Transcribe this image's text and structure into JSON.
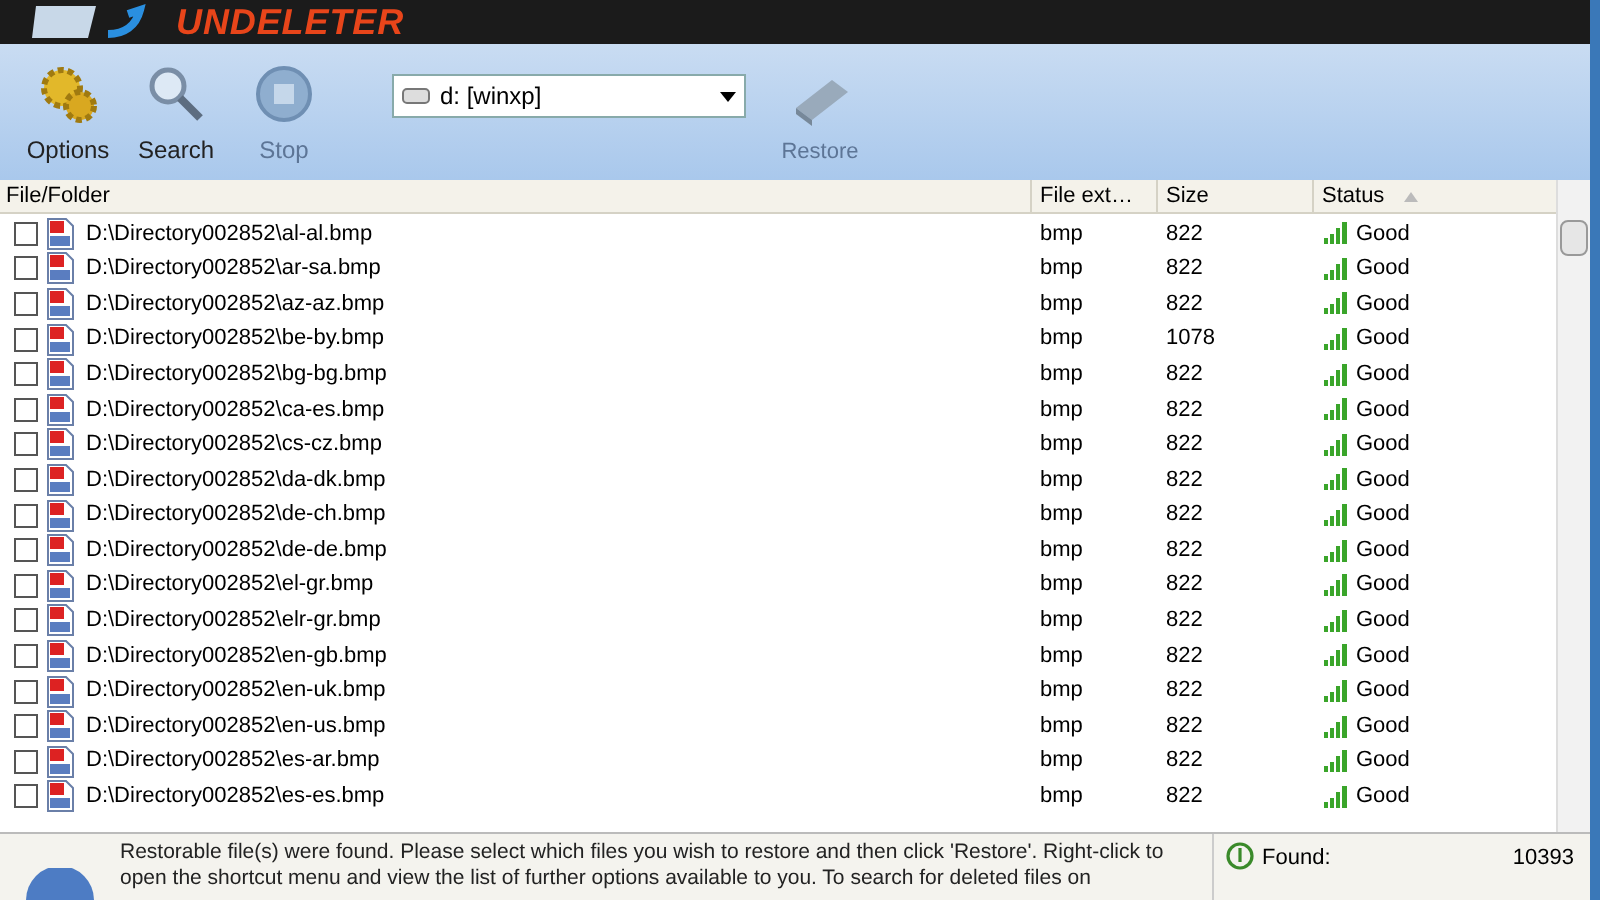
{
  "app": {
    "logo": "UNDELETER"
  },
  "toolbar": {
    "buttons": [
      {
        "kind": "options",
        "label": "Options",
        "disabled": false
      },
      {
        "kind": "search",
        "label": "Search",
        "disabled": false
      },
      {
        "kind": "stop",
        "label": "Stop",
        "disabled": true
      }
    ],
    "drive": {
      "value": "d: [winxp]"
    },
    "restore": {
      "label": "Restore",
      "disabled": true
    }
  },
  "table": {
    "columns": [
      "File/Folder",
      "File ext…",
      "Size",
      "Status"
    ],
    "rows": [
      {
        "path": "D:\\Directory002852\\al-al.bmp",
        "ext": "bmp",
        "size": "822",
        "status": "Good",
        "checked": false
      },
      {
        "path": "D:\\Directory002852\\ar-sa.bmp",
        "ext": "bmp",
        "size": "822",
        "status": "Good",
        "checked": false
      },
      {
        "path": "D:\\Directory002852\\az-az.bmp",
        "ext": "bmp",
        "size": "822",
        "status": "Good",
        "checked": false
      },
      {
        "path": "D:\\Directory002852\\be-by.bmp",
        "ext": "bmp",
        "size": "1078",
        "status": "Good",
        "checked": false
      },
      {
        "path": "D:\\Directory002852\\bg-bg.bmp",
        "ext": "bmp",
        "size": "822",
        "status": "Good",
        "checked": false
      },
      {
        "path": "D:\\Directory002852\\ca-es.bmp",
        "ext": "bmp",
        "size": "822",
        "status": "Good",
        "checked": false
      },
      {
        "path": "D:\\Directory002852\\cs-cz.bmp",
        "ext": "bmp",
        "size": "822",
        "status": "Good",
        "checked": false
      },
      {
        "path": "D:\\Directory002852\\da-dk.bmp",
        "ext": "bmp",
        "size": "822",
        "status": "Good",
        "checked": false
      },
      {
        "path": "D:\\Directory002852\\de-ch.bmp",
        "ext": "bmp",
        "size": "822",
        "status": "Good",
        "checked": false
      },
      {
        "path": "D:\\Directory002852\\de-de.bmp",
        "ext": "bmp",
        "size": "822",
        "status": "Good",
        "checked": false
      },
      {
        "path": "D:\\Directory002852\\el-gr.bmp",
        "ext": "bmp",
        "size": "822",
        "status": "Good",
        "checked": false
      },
      {
        "path": "D:\\Directory002852\\elr-gr.bmp",
        "ext": "bmp",
        "size": "822",
        "status": "Good",
        "checked": false
      },
      {
        "path": "D:\\Directory002852\\en-gb.bmp",
        "ext": "bmp",
        "size": "822",
        "status": "Good",
        "checked": false
      },
      {
        "path": "D:\\Directory002852\\en-uk.bmp",
        "ext": "bmp",
        "size": "822",
        "status": "Good",
        "checked": false
      },
      {
        "path": "D:\\Directory002852\\en-us.bmp",
        "ext": "bmp",
        "size": "822",
        "status": "Good",
        "checked": false
      },
      {
        "path": "D:\\Directory002852\\es-ar.bmp",
        "ext": "bmp",
        "size": "822",
        "status": "Good",
        "checked": false
      },
      {
        "path": "D:\\Directory002852\\es-es.bmp",
        "ext": "bmp",
        "size": "822",
        "status": "Good",
        "checked": false
      }
    ]
  },
  "status_bar": {
    "message": "Restorable file(s) were found. Please select which files you wish to restore and then click 'Restore'. Right-click to open the shortcut menu and view the list of further options available to you. To search for deleted files on",
    "found_label": "Found:",
    "found_value": "10393"
  }
}
